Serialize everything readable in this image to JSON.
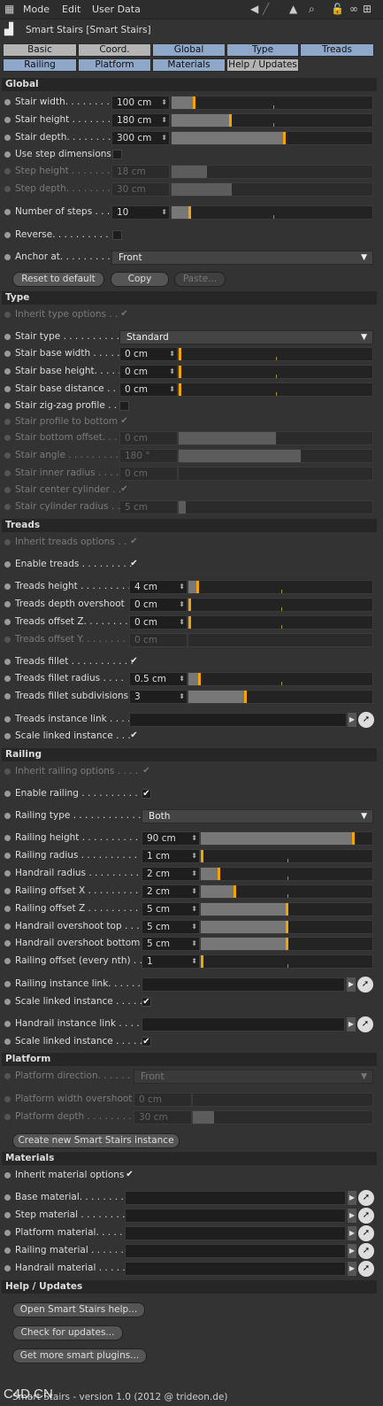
{
  "menu": {
    "mode": "Mode",
    "edit": "Edit",
    "user_data": "User Data"
  },
  "title": "Smart Stairs [Smart Stairs]",
  "tabs": {
    "basic": "Basic",
    "coord": "Coord.",
    "global": "Global",
    "type": "Type",
    "treads": "Treads",
    "railing": "Railing",
    "platform": "Platform",
    "materials": "Materials",
    "help": "Help / Updates"
  },
  "sections": {
    "global": "Global",
    "type": "Type",
    "treads": "Treads",
    "railing": "Railing",
    "platform": "Platform",
    "materials": "Materials",
    "help": "Help / Updates"
  },
  "global": {
    "stair_width": {
      "label": "Stair width. . . . . . . . .",
      "value": "100 cm"
    },
    "stair_height": {
      "label": "Stair height . . . . . . . .",
      "value": "180 cm"
    },
    "stair_depth": {
      "label": "Stair depth. . . . . . . . .",
      "value": "300 cm"
    },
    "use_step_dimensions": {
      "label": "Use step dimensions"
    },
    "step_height": {
      "label": "Step height . . . . . . . .",
      "value": "18 cm"
    },
    "step_depth": {
      "label": "Step depth. . . . . . . . .",
      "value": "30 cm"
    },
    "number_of_steps": {
      "label": "Number of steps . . .",
      "value": "10"
    },
    "reverse": {
      "label": "Reverse. . . . . . . . . . ."
    },
    "anchor_at": {
      "label": "Anchor at. . . . . . . . .",
      "value": "Front"
    },
    "reset": "Reset to default",
    "copy": "Copy",
    "paste": "Paste..."
  },
  "type": {
    "inherit": {
      "label": "Inherit type options . ."
    },
    "stair_type": {
      "label": "Stair type . . . . . . . . . . .",
      "value": "Standard"
    },
    "base_width": {
      "label": "Stair base width . . . . .",
      "value": "0 cm"
    },
    "base_height": {
      "label": "Stair base height. . . . .",
      "value": "0 cm"
    },
    "base_distance": {
      "label": "Stair base distance . . .",
      "value": "0 cm"
    },
    "zigzag": {
      "label": "Stair zig-zag profile . ."
    },
    "profile_bottom": {
      "label": "Stair profile to bottom"
    },
    "bottom_offset": {
      "label": "Stair bottom offset. . .",
      "value": "0 cm"
    },
    "angle": {
      "label": "Stair angle . . . . . . . . .",
      "value": "180 °"
    },
    "inner_radius": {
      "label": "Stair inner radius . . . .",
      "value": "0 cm"
    },
    "center_cylinder": {
      "label": "Stair center cylinder . ."
    },
    "cylinder_radius": {
      "label": "Stair cylinder radius . .",
      "value": "5 cm"
    }
  },
  "treads": {
    "inherit": {
      "label": "Inherit treads options . ."
    },
    "enable": {
      "label": "Enable treads . . . . . . . . ."
    },
    "height": {
      "label": "Treads height . . . . . . . . .",
      "value": "4 cm"
    },
    "depth_overshoot": {
      "label": "Treads depth overshoot",
      "value": "0 cm"
    },
    "offset_z": {
      "label": "Treads offset Z. . . . . . . .",
      "value": "0 cm"
    },
    "offset_y": {
      "label": "Treads offset Y. . . . . . . .",
      "value": "0 cm"
    },
    "fillet": {
      "label": "Treads fillet . . . . . . . . . . ."
    },
    "fillet_radius": {
      "label": "Treads fillet radius . . . .",
      "value": "0.5 cm"
    },
    "fillet_subdiv": {
      "label": "Treads fillet subdivisions",
      "value": "3"
    },
    "instance_link": {
      "label": "Treads instance link . . . ."
    },
    "scale_linked": {
      "label": "Scale linked instance . . ."
    }
  },
  "railing": {
    "inherit": {
      "label": "Inherit railing options . . . ."
    },
    "enable": {
      "label": "Enable railing . . . . . . . . . . ."
    },
    "type": {
      "label": "Railing type . . . . . . . . . . . .",
      "value": "Both"
    },
    "height": {
      "label": "Railing height . . . . . . . . . .",
      "value": "90 cm"
    },
    "radius": {
      "label": "Railing radius . . . . . . . . . .",
      "value": "1 cm"
    },
    "handrail_radius": {
      "label": "Handrail radius . . . . . . . . .",
      "value": "2 cm"
    },
    "offset_x": {
      "label": "Railing offset X . . . . . . . . .",
      "value": "2 cm"
    },
    "offset_z": {
      "label": "Railing offset Z . . . . . . . . .",
      "value": "5 cm"
    },
    "overshoot_top": {
      "label": "Handrail overshoot top . . .",
      "value": "5 cm"
    },
    "overshoot_bottom": {
      "label": "Handrail overshoot bottom",
      "value": "5 cm"
    },
    "offset_nth": {
      "label": "Railing offset (every nth) . .",
      "value": "1"
    },
    "instance_link": {
      "label": "Railing instance link. . . . . ."
    },
    "scale_linked": {
      "label": "Scale linked instance . . . . ."
    },
    "handrail_link": {
      "label": "Handrail instance link . . . ."
    },
    "handrail_scale": {
      "label": "Scale linked instance . . . . ."
    }
  },
  "platform": {
    "direction": {
      "label": "Platform direction. . . . . . .",
      "value": "Front"
    },
    "width_overshoot": {
      "label": "Platform width overshoot",
      "value": "0 cm"
    },
    "depth": {
      "label": "Platform depth . . . . . . . .",
      "value": "30 cm"
    },
    "create": "Create new Smart Stairs instance"
  },
  "materials": {
    "inherit": {
      "label": "Inherit material options"
    },
    "base": {
      "label": "Base material. . . . . . . . . ."
    },
    "step": {
      "label": "Step material . . . . . . . . . ."
    },
    "platform": {
      "label": "Platform material. . . . . . ."
    },
    "railing": {
      "label": "Railing material . . . . . . . ."
    },
    "handrail": {
      "label": "Handrail material . . . . . . ."
    }
  },
  "help": {
    "open": "Open Smart Stairs help...",
    "check": "Check for updates...",
    "more": "Get more smart plugins..."
  },
  "footer": "Smart Stairs - version 1.0 (2012 @ trideon.de)",
  "watermark": "C4D.CN",
  "colors": {
    "accent": "#f2a500",
    "tab_active": "#8fa7c9",
    "tab": "#7a8fa8",
    "section": "#262626",
    "background": "#333333"
  }
}
